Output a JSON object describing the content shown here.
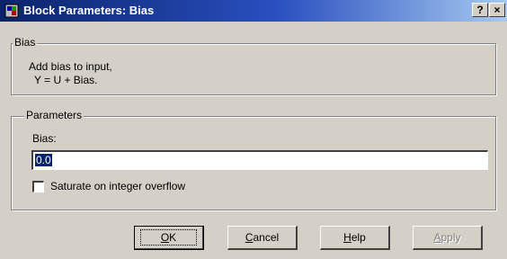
{
  "window": {
    "title": "Block Parameters: Bias",
    "help_button": "?",
    "close_button": "×"
  },
  "bias_group": {
    "legend": "Bias",
    "description_line1": "Add bias to input,",
    "description_line2": "Y = U + Bias."
  },
  "parameters_group": {
    "legend": "Parameters",
    "bias_label": "Bias:",
    "bias_value": "0.0",
    "saturate_label": "Saturate on integer overflow",
    "saturate_checked": false
  },
  "buttons": {
    "ok": {
      "mnemonic": "O",
      "rest": "K"
    },
    "cancel": {
      "mnemonic": "C",
      "rest": "ancel"
    },
    "help": {
      "mnemonic": "H",
      "rest": "elp"
    },
    "apply": {
      "mnemonic": "A",
      "rest": "pply",
      "enabled": false
    }
  },
  "icons": {
    "app": "simulink-block-icon"
  }
}
